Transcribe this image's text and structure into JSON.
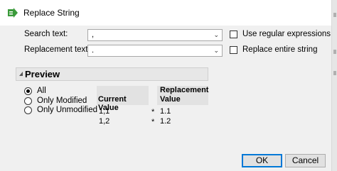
{
  "window": {
    "title": "Replace String",
    "icon": "jmp-app-icon"
  },
  "form": {
    "search_label": "Search text:",
    "search_value": ",",
    "replacement_label": "Replacement text:",
    "replacement_value": ".",
    "use_regex_label": "Use regular expressions",
    "use_regex_checked": false,
    "replace_entire_label": "Replace entire string",
    "replace_entire_checked": false
  },
  "preview": {
    "title": "Preview",
    "filter_options": [
      "All",
      "Only Modified",
      "Only Unmodified"
    ],
    "filter_selected": "All",
    "columns": [
      "Current Value",
      "Replacement",
      "Value"
    ],
    "rows": [
      {
        "current": "1,1",
        "marker": "*",
        "replacement": "1.1"
      },
      {
        "current": "1,2",
        "marker": "*",
        "replacement": "1.2"
      }
    ]
  },
  "buttons": {
    "ok": "OK",
    "cancel": "Cancel"
  },
  "colors": {
    "accent": "#0078d7",
    "icon_green": "#3a9a3a"
  }
}
